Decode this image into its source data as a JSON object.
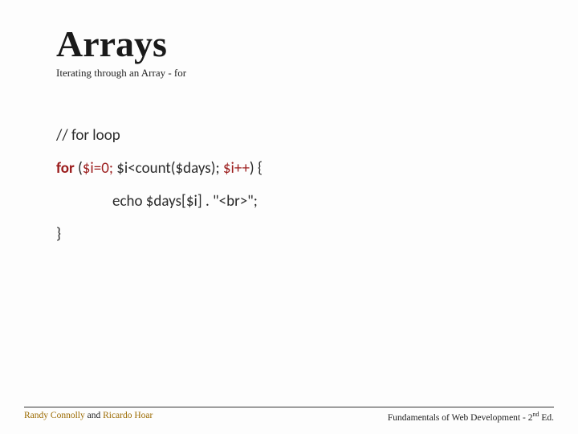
{
  "header": {
    "title": "Arrays",
    "subtitle": "Iterating through an Array - for"
  },
  "code": {
    "comment": "// for loop",
    "for_kw": "for",
    "for_open": " (",
    "init": "$i=0;",
    "cond": " $i<count($days); ",
    "incr": "$i++",
    "for_close": ") {",
    "body": "echo $days[$i] . \"<br>\";",
    "close": "}"
  },
  "footer": {
    "author1": "Randy Connolly",
    "and": " and ",
    "author2": "Ricardo Hoar",
    "book_prefix": "Fundamentals of Web Development - 2",
    "book_sup": "nd",
    "book_suffix": " Ed."
  }
}
